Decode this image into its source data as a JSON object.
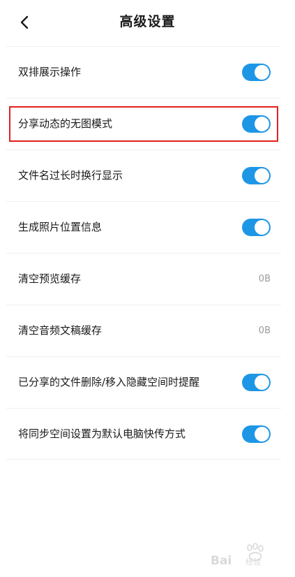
{
  "header": {
    "title": "高级设置",
    "back_icon": "chevron-left-icon"
  },
  "settings": [
    {
      "label": "双排展示操作",
      "type": "toggle",
      "on": true
    },
    {
      "label": "分享动态的无图模式",
      "type": "toggle",
      "on": true,
      "highlighted": true
    },
    {
      "label": "文件名过长时换行显示",
      "type": "toggle",
      "on": true
    },
    {
      "label": "生成照片位置信息",
      "type": "toggle",
      "on": true
    },
    {
      "label": "清空预览缓存",
      "type": "value",
      "value": "0B"
    },
    {
      "label": "清空音频文稿缓存",
      "type": "value",
      "value": "0B"
    },
    {
      "label": "已分享的文件删除/移入隐藏空间时提醒",
      "type": "toggle",
      "on": true
    },
    {
      "label": "将同步空间设置为默认电脑快传方式",
      "type": "toggle",
      "on": true
    }
  ],
  "colors": {
    "toggle_on": "#1e96e6",
    "highlight_border": "#e02020"
  }
}
